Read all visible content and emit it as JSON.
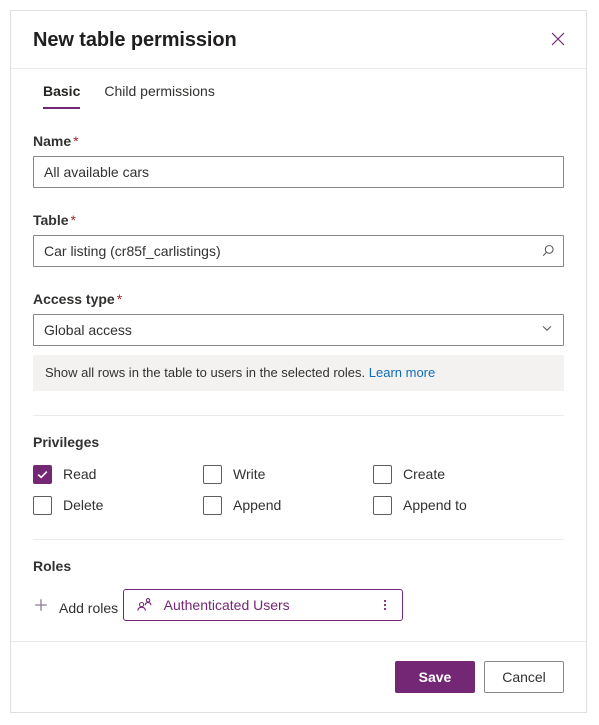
{
  "dialog": {
    "title": "New table permission",
    "close_icon": "close-icon"
  },
  "tabs": [
    {
      "label": "Basic",
      "active": true
    },
    {
      "label": "Child permissions",
      "active": false
    }
  ],
  "fields": {
    "name": {
      "label": "Name",
      "required_marker": "*",
      "value": "All available cars",
      "placeholder": ""
    },
    "table": {
      "label": "Table",
      "required_marker": "*",
      "value": "Car listing (cr85f_carlistings)",
      "placeholder": "",
      "icon": "search-icon"
    },
    "access_type": {
      "label": "Access type",
      "required_marker": "*",
      "value": "Global access",
      "icon": "chevron-down-icon"
    }
  },
  "info_banner": {
    "text": "Show all rows in the table to users in the selected roles.",
    "link_label": "Learn more"
  },
  "privileges": {
    "title": "Privileges",
    "items": [
      {
        "label": "Read",
        "checked": true
      },
      {
        "label": "Write",
        "checked": false
      },
      {
        "label": "Create",
        "checked": false
      },
      {
        "label": "Delete",
        "checked": false
      },
      {
        "label": "Append",
        "checked": false
      },
      {
        "label": "Append to",
        "checked": false
      }
    ]
  },
  "roles": {
    "title": "Roles",
    "add_label": "Add roles",
    "add_icon": "plus-icon",
    "chips": [
      {
        "label": "Authenticated Users",
        "icon": "contact-person-icon",
        "menu_icon": "more-vertical-icon"
      }
    ]
  },
  "footer": {
    "save_label": "Save",
    "cancel_label": "Cancel"
  },
  "colors": {
    "accent": "#742774",
    "required": "#a4262c",
    "link": "#0f6cbd",
    "banner_bg": "#f3f2f1",
    "border": "#8a8886",
    "divider": "#edebe9"
  }
}
